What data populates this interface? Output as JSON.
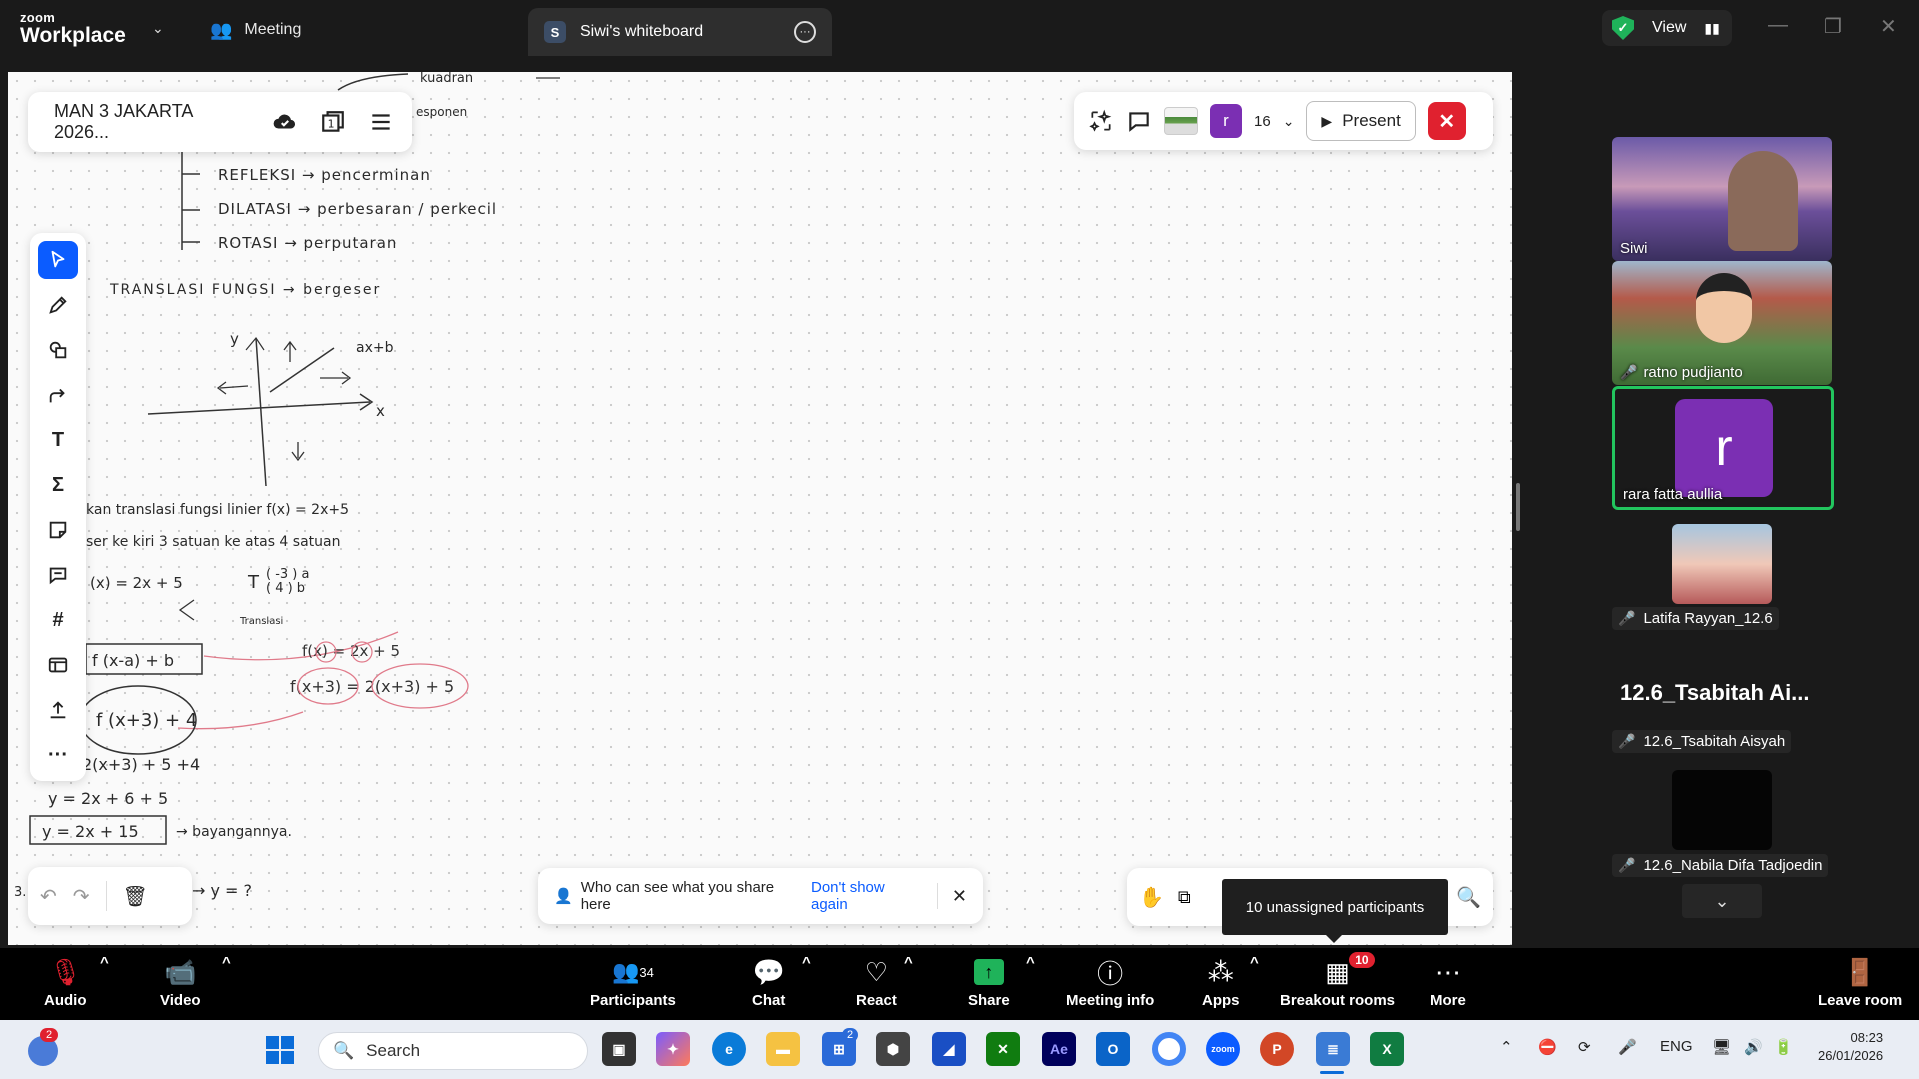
{
  "titlebar": {
    "brand_small": "zoom",
    "brand_big": "Workplace",
    "meeting_tab": "Meeting",
    "whiteboard_tab": "Siwi's whiteboard",
    "whiteboard_badge": "S",
    "view_label": "View"
  },
  "whiteboard": {
    "title": "MAN 3 JAKARTA  2026...",
    "participant_initial": "r",
    "participant_count": "16",
    "present_label": "Present",
    "notice_text": "Who can see what you share here",
    "notice_link": "Don't show again",
    "tooltip": "10 unassigned participants",
    "handwriting": {
      "line_kuadran": "kuadran",
      "line_espenan": "esponen",
      "line_refleksi": "REFLEKSI  →  pencerminan",
      "line_dilatasi": "DILATASI  →  perbesaran / perkecil",
      "line_rotasi": "ROTASI  →  perputaran",
      "line_translasi": "TRANSLASI  FUNGSI   →  bergeser",
      "graph_y": "y",
      "graph_x": "x",
      "graph_eq": "ax+b",
      "problem_1": "kan  translasi  fungsi  linier  f(x) = 2x+5",
      "problem_2": "ser  ke  kiri  3  satuan  ke  atas  4  satuan",
      "eq_fx": "(x) = 2x + 5",
      "eq_T": "T",
      "eq_matrix": "( -3 )  a\n(  4 )  b",
      "eq_translasi": "Translasi",
      "eq_rule": "f (x-a) + b",
      "eq_f_pink": "f(x) = 2x + 5",
      "eq_sub": "f(x+3) = 2(x+3) + 5",
      "eq_circle": "f (x+3) + 4",
      "eq_step": "2(x+3) + 5  +4",
      "eq_step2": "y = 2x + 6 + 5",
      "eq_result": "y = 2x + 15",
      "eq_arrow": "→ bayangannya.",
      "eq_bottom": "→  y = ?",
      "margin_num": "3."
    }
  },
  "participants": [
    {
      "name": "Siwi",
      "muted": false
    },
    {
      "name": "ratno pudjianto",
      "muted": true
    },
    {
      "name": "rara fatta aullia",
      "muted": false,
      "initial": "r",
      "active": true
    },
    {
      "name": "Latifa Rayyan_12.6",
      "muted": true
    },
    {
      "name": "12.6_Tsabitah Aisyah",
      "muted": true,
      "big_name": "12.6_Tsabitah  Ai..."
    },
    {
      "name": "12.6_Nabila Difa Tadjoedin",
      "muted": true
    }
  ],
  "controls": {
    "audio": "Audio",
    "video": "Video",
    "participants": "Participants",
    "participants_count": "34",
    "chat": "Chat",
    "react": "React",
    "share": "Share",
    "meeting_info": "Meeting info",
    "apps": "Apps",
    "breakout": "Breakout rooms",
    "breakout_badge": "10",
    "more": "More",
    "leave": "Leave room"
  },
  "taskbar": {
    "search_placeholder": "Search",
    "notif_badge": "2",
    "store_badge": "2",
    "lang": "ENG",
    "time": "08:23",
    "date": "26/01/2026"
  },
  "colors": {
    "accent": "#0b5cff",
    "danger": "#e0212f",
    "active_border": "#22c55e",
    "avatar_purple": "#7b2fb3",
    "ink_pink": "#e07a8a"
  }
}
